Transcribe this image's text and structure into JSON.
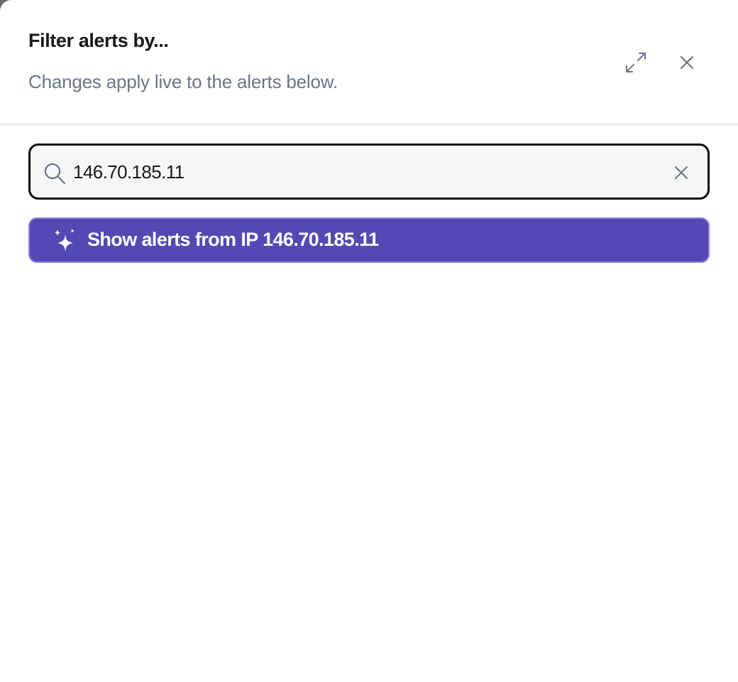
{
  "panel": {
    "title": "Filter alerts by...",
    "subtitle": "Changes apply live to the alerts below.",
    "expand_icon": "expand-icon",
    "close_icon": "close-icon"
  },
  "search": {
    "value": "146.70.185.11",
    "icon": "search-icon",
    "clear_icon": "clear-icon"
  },
  "suggestion": {
    "label": "Show alerts from IP 146.70.185.11",
    "icon": "sparkle-icon"
  },
  "colors": {
    "accent": "#5448b4",
    "subtitle": "#67768a",
    "title": "#16181d",
    "input_background": "#f5f7f6"
  }
}
